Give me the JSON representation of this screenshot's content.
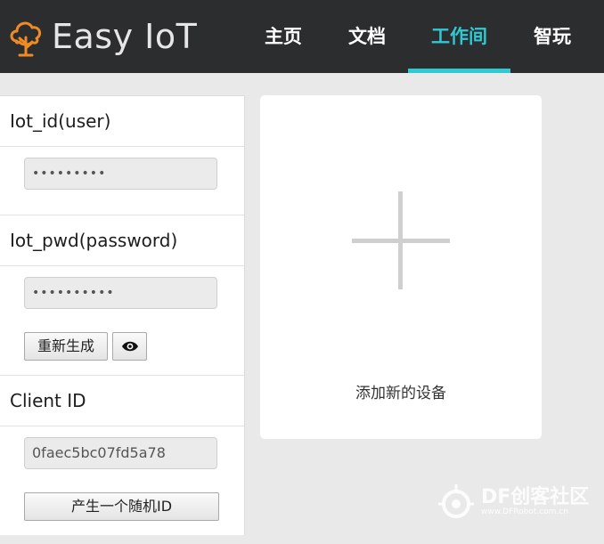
{
  "brand": {
    "name": "Easy IoT",
    "logo_icon": "cloud-tree-icon",
    "accent_color": "#f08a24"
  },
  "nav": {
    "active_color": "#2fc9d4",
    "items": [
      {
        "label": "主页"
      },
      {
        "label": "文档"
      },
      {
        "label": "工作间"
      },
      {
        "label": "智玩"
      }
    ],
    "active_index": 2
  },
  "credentials": {
    "user_title": "Iot_id(user)",
    "user_value": "•••••••••",
    "pwd_title": "Iot_pwd(password)",
    "pwd_value": "••••••••••",
    "regenerate_label": "重新生成",
    "show_icon": "eye-icon",
    "client_title": "Client ID",
    "client_value": "0faec5bc07fd5a78",
    "random_id_label": "产生一个随机ID"
  },
  "device_card": {
    "add_label": "添加新的设备",
    "icon": "plus-icon"
  },
  "watermark": {
    "title": "DF创客社区",
    "url": "www.DFRobot.com.cn"
  }
}
